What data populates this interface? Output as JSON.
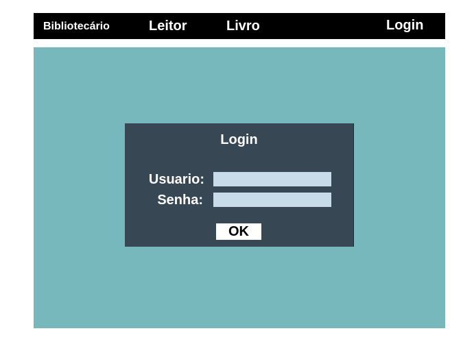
{
  "navbar": {
    "items": [
      {
        "label": "Bibliotecário"
      },
      {
        "label": "Leitor"
      },
      {
        "label": "Livro"
      },
      {
        "label": "Login"
      }
    ]
  },
  "login_dialog": {
    "title": "Login",
    "username_label": "Usuario:",
    "username_value": "",
    "password_label": "Senha:",
    "password_value": "",
    "ok_label": "OK"
  },
  "colors": {
    "navbar_bg": "#000000",
    "content_bg": "#77b8bd",
    "dialog_bg": "#374754",
    "input_bg": "#c8dbe8",
    "button_bg": "#ffffff"
  }
}
